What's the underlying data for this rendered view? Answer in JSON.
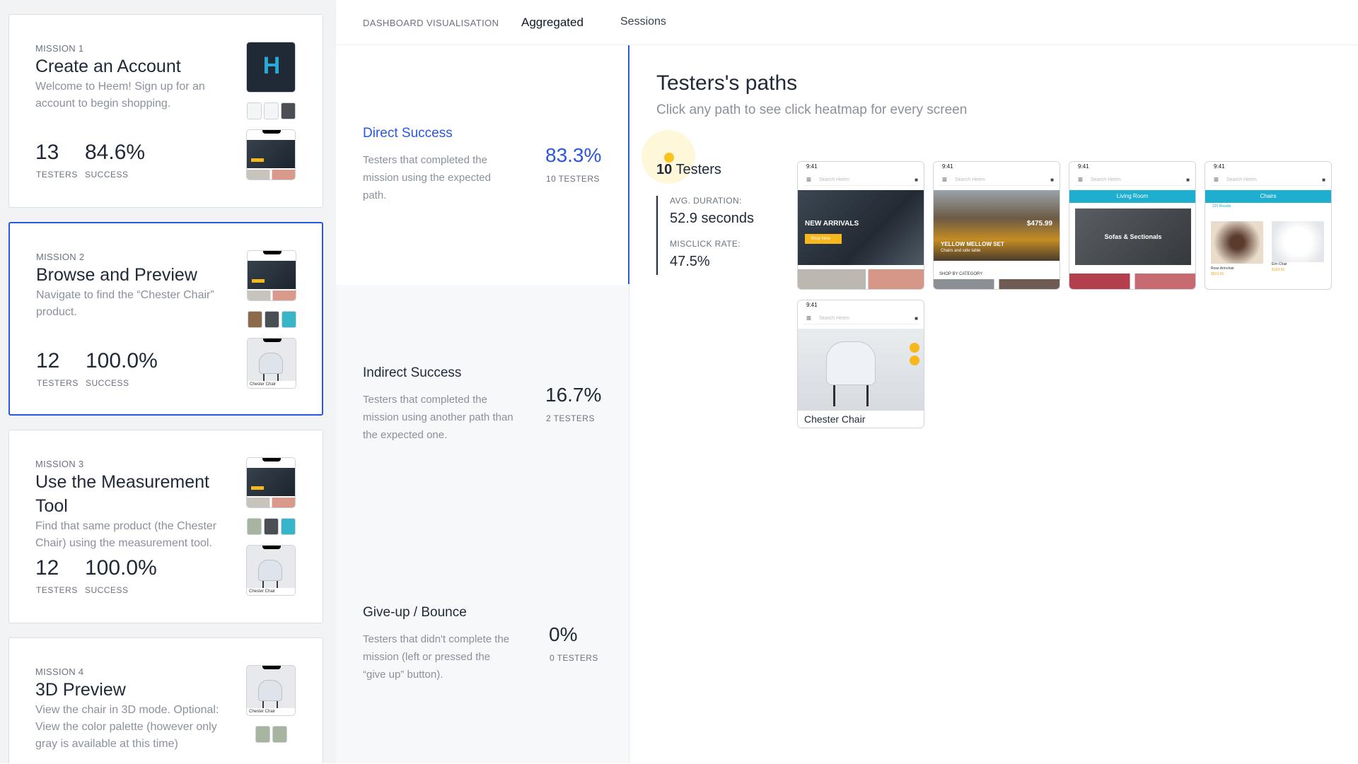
{
  "missions": [
    {
      "label": "MISSION 1",
      "title": "Create an Account",
      "desc": "Welcome to Heem! Sign up for an account to begin shopping.",
      "testers": "13",
      "testers_caption": "TESTERS",
      "success": "84.6%",
      "success_caption": "SUCCESS"
    },
    {
      "label": "MISSION 2",
      "title": "Browse and Preview",
      "desc": "Navigate to find the “Chester Chair” product.",
      "testers": "12",
      "testers_caption": "TESTERS",
      "success": "100.0%",
      "success_caption": "SUCCESS",
      "thumb_caption": "Chester Chair"
    },
    {
      "label": "MISSION 3",
      "title": "Use the Measurement Tool",
      "desc": "Find that same product (the Chester Chair) using the measurement tool.",
      "testers": "12",
      "testers_caption": "TESTERS",
      "success": "100.0%",
      "success_caption": "SUCCESS",
      "thumb_caption": "Chester Chair"
    },
    {
      "label": "MISSION 4",
      "title": "3D Preview",
      "desc": "View the chair in 3D mode. Optional: View the color palette (however only gray is available at this time)",
      "thumb_caption": "Chester Chair"
    }
  ],
  "nav": {
    "dashboard": "DASHBOARD VISUALISATION",
    "aggregated": "Aggregated",
    "sessions": "Sessions"
  },
  "outcomes": [
    {
      "title": "Direct Success",
      "desc": "Testers that completed the mission using the expected path.",
      "value": "83.3%",
      "caption": "10 TESTERS"
    },
    {
      "title": "Indirect Success",
      "desc": "Testers that completed the mission using another path than the expected one.",
      "value": "16.7%",
      "caption": "2 TESTERS"
    },
    {
      "title": "Give-up / Bounce",
      "desc": "Testers that didn't complete the mission (left or pressed the “give up” button).",
      "value": "0%",
      "caption": "0 TESTERS"
    }
  ],
  "paths": {
    "title": "Testers's paths",
    "subtitle": "Click any path to see click heatmap for every screen",
    "testers_count": "10",
    "testers_label": "Testers",
    "avg_duration_caption": "AVG. DURATION:",
    "avg_duration": "52.9 seconds",
    "misclick_caption": "MISCLICK RATE:",
    "misclick": "47.5%",
    "screens": [
      {
        "time": "9:41",
        "search": "Search Heem",
        "hero": "NEW ARRIVALS",
        "button": "Shop Now"
      },
      {
        "time": "9:41",
        "search": "Search Heem",
        "hero": "YELLOW MELLOW SET",
        "sub": "Chairs and side table",
        "price": "$475.99",
        "section": "SHOP BY CATEGORY"
      },
      {
        "time": "9:41",
        "search": "Search Heem",
        "header": "Living Room",
        "tile": "Sofas & Sectionals"
      },
      {
        "time": "9:41",
        "search": "Search Heem",
        "header": "Chairs",
        "results": "120 Results",
        "item1": "Rose Armchair",
        "price1": "$423.99",
        "item2": "Elm Chair",
        "price2": "$199.99"
      },
      {
        "time": "9:41",
        "search": "Search Heem",
        "caption": "Chester Chair"
      }
    ]
  },
  "colors": {
    "accent": "#2a56e0",
    "yellow": "#f8c41d",
    "teal": "#1eaed0"
  }
}
